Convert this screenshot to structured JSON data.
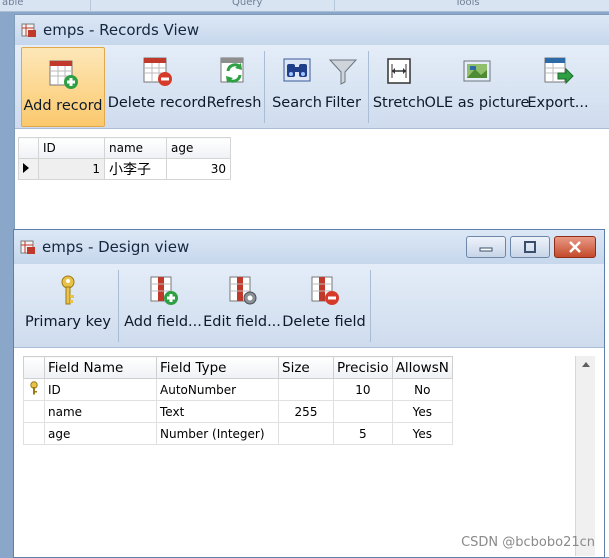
{
  "top_strip": {
    "left_label": "able",
    "query_label": "Query",
    "tools_label": "Tools"
  },
  "records_window": {
    "title": "emps - Records View",
    "toolbar": {
      "add_record": "Add record",
      "delete_record": "Delete record",
      "refresh": "Refresh",
      "search": "Search",
      "filter": "Filter",
      "stretch": "Stretch",
      "ole_as_picture": "OLE as picture",
      "export": "Export..."
    },
    "grid": {
      "columns": [
        "ID",
        "name",
        "age"
      ],
      "rows": [
        {
          "id": "1",
          "name": "小李子",
          "age": "30"
        }
      ]
    }
  },
  "design_window": {
    "title": "emps - Design view",
    "toolbar": {
      "primary_key": "Primary key",
      "add_field": "Add field...",
      "edit_field": "Edit field...",
      "delete_field": "Delete field"
    },
    "grid": {
      "columns": [
        "Field Name",
        "Field Type",
        "Size",
        "Precisio",
        "AllowsN"
      ],
      "rows": [
        {
          "name": "ID",
          "type": "AutoNumber",
          "size": "",
          "precision": "10",
          "allows_null": "No",
          "primary": true
        },
        {
          "name": "name",
          "type": "Text",
          "size": "255",
          "precision": "",
          "allows_null": "Yes",
          "primary": false
        },
        {
          "name": "age",
          "type": "Number (Integer)",
          "size": "",
          "precision": "5",
          "allows_null": "Yes",
          "primary": false
        }
      ]
    }
  },
  "watermark": "CSDN @bcbobo21cn",
  "colors": {
    "active_button": "#fbc96d",
    "close_button": "#c44a2b",
    "desktop": "#8aa7c9"
  }
}
